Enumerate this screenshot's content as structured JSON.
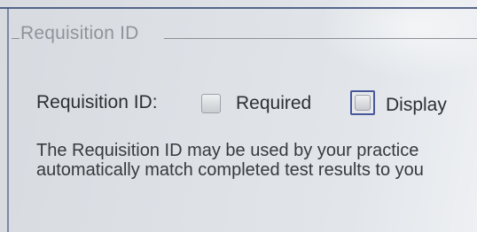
{
  "group": {
    "legend": "Requisition ID"
  },
  "field": {
    "label": "Requisition ID:",
    "required_label": "Required",
    "display_label": "Display",
    "required_checked": false,
    "display_checked": false
  },
  "description": {
    "line1": "The Requisition ID may be used by your practice",
    "line2": "automatically match completed test results to you"
  }
}
